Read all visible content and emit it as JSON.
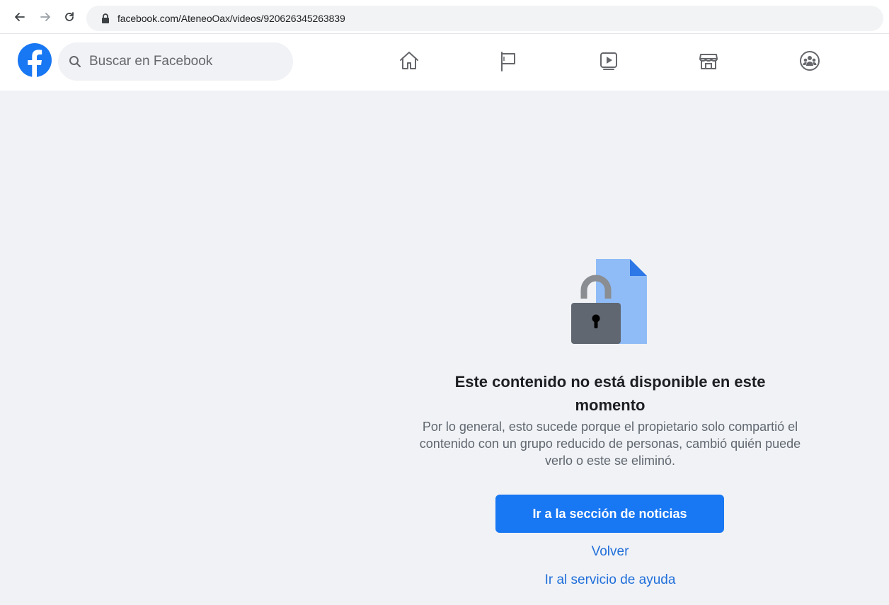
{
  "browser": {
    "back_icon": "arrow-left-icon",
    "forward_icon": "arrow-right-icon",
    "reload_icon": "reload-icon",
    "url": "facebook.com/AteneoOax/videos/920626345263839"
  },
  "header": {
    "logo_icon": "facebook-logo-icon",
    "search_placeholder": "Buscar en Facebook",
    "tabs": [
      {
        "icon": "home-icon"
      },
      {
        "icon": "flag-icon"
      },
      {
        "icon": "watch-video-icon"
      },
      {
        "icon": "marketplace-icon"
      },
      {
        "icon": "groups-icon"
      }
    ]
  },
  "colors": {
    "accent": "#1877f2",
    "link": "#216fdb",
    "page_bg": "#f0f2f5"
  },
  "content": {
    "illustration_icon": "locked-document-icon",
    "title": "Este contenido no está disponible en este momento",
    "description": "Por lo general, esto sucede porque el propietario solo compartió el contenido con un grupo reducido de personas, cambió quién puede verlo o este se eliminó.",
    "primary_button": "Ir a la sección de noticias",
    "back_link": "Volver",
    "help_link": "Ir al servicio de ayuda"
  }
}
